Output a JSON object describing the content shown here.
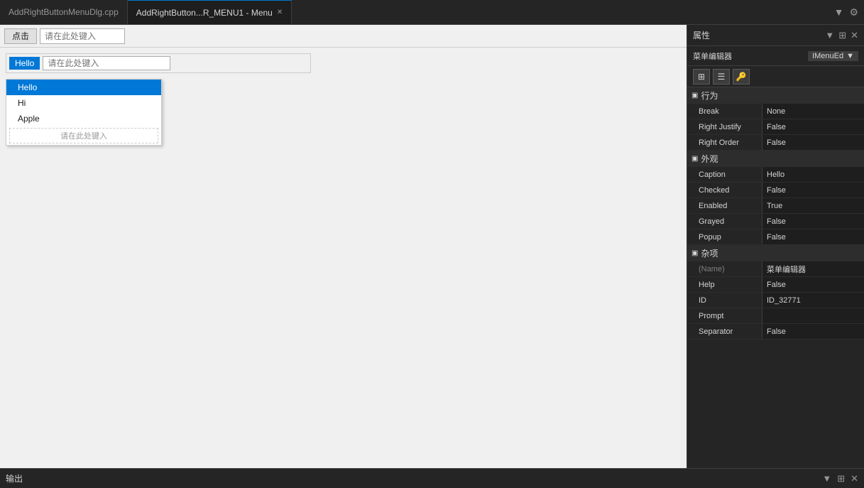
{
  "tabs": [
    {
      "id": "cpp",
      "label": "AddRightButtonMenuDlg.cpp",
      "active": false,
      "closable": false
    },
    {
      "id": "menu",
      "label": "AddRightButton...R_MENU1 - Menu",
      "active": true,
      "closable": true
    }
  ],
  "tab_actions": {
    "pin_icon": "⊞",
    "gear_icon": "⚙"
  },
  "toolbar": {
    "button_label": "点击",
    "input_placeholder": "请在此处键入"
  },
  "menu_bar": {
    "item_label": "Hello",
    "input_placeholder": "请在此处键入"
  },
  "dropdown": {
    "items": [
      "Hello",
      "Hi",
      "Apple"
    ],
    "placeholder": "请在此处键入",
    "selected_index": 0
  },
  "properties": {
    "panel_title": "属性",
    "header_icons": {
      "pin": "📌",
      "close": "✕",
      "down_arrow": "▼"
    },
    "selector_label": "菜单编辑器",
    "selector_value": "IMenuEd",
    "groups": [
      {
        "name": "行为",
        "collapsed": false,
        "properties": [
          {
            "name": "Break",
            "value": "None",
            "dimmed": false
          },
          {
            "name": "Right Justify",
            "value": "False",
            "dimmed": false
          },
          {
            "name": "Right Order",
            "value": "False",
            "dimmed": false
          }
        ]
      },
      {
        "name": "外观",
        "collapsed": false,
        "properties": [
          {
            "name": "Caption",
            "value": "Hello",
            "dimmed": false
          },
          {
            "name": "Checked",
            "value": "False",
            "dimmed": false
          },
          {
            "name": "Enabled",
            "value": "True",
            "dimmed": false
          },
          {
            "name": "Grayed",
            "value": "False",
            "dimmed": false
          },
          {
            "name": "Popup",
            "value": "False",
            "dimmed": false
          }
        ]
      },
      {
        "name": "杂项",
        "collapsed": false,
        "properties": [
          {
            "name": "(Name)",
            "value": "菜单编辑器",
            "dimmed": true
          },
          {
            "name": "Help",
            "value": "False",
            "dimmed": false
          },
          {
            "name": "ID",
            "value": "ID_32771",
            "dimmed": false
          },
          {
            "name": "Prompt",
            "value": "",
            "dimmed": false
          },
          {
            "name": "Separator",
            "value": "False",
            "dimmed": false
          }
        ]
      }
    ]
  },
  "output_panel": {
    "label": "输出"
  }
}
